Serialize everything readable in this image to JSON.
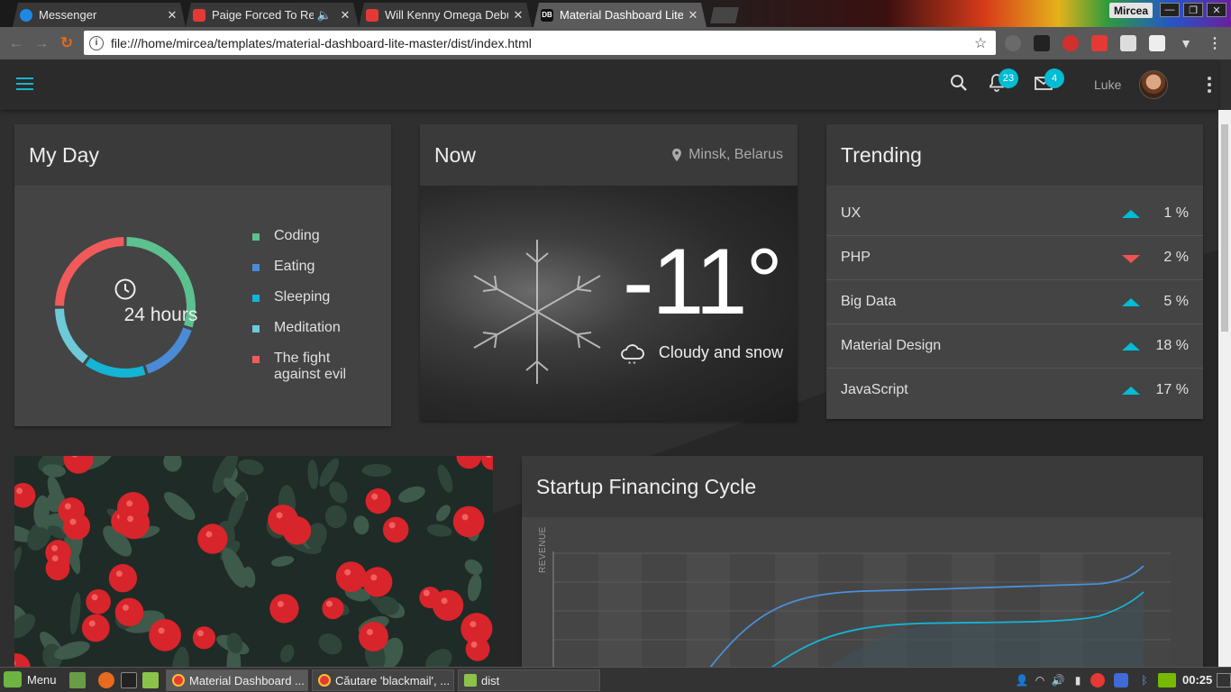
{
  "browser": {
    "tabs": [
      {
        "title": "Messenger",
        "close": "✕",
        "favicon_color": "#1e88e5"
      },
      {
        "title": "Paige Forced To Reti",
        "close": "✕",
        "favicon_color": "#e53935"
      },
      {
        "title": "Will Kenny Omega Debu",
        "close": "✕",
        "favicon_color": "#e53935"
      },
      {
        "title": "Material Dashboard Lite",
        "close": "✕",
        "favicon_text": "DB"
      }
    ],
    "profile_name": "Mircea",
    "window_buttons": {
      "minimize": "—",
      "maximize": "❐",
      "close": "✕"
    },
    "url": "file:///home/mircea/templates/material-dashboard-lite-master/dist/index.html",
    "info_glyph": "i",
    "star_glyph": "☆",
    "nav": {
      "back": "←",
      "forward": "→",
      "reload": "↻"
    }
  },
  "header": {
    "notifications_count": "23",
    "messages_count": "4",
    "user_name": "Luke"
  },
  "my_day": {
    "title": "My Day",
    "center_label": "24 hours",
    "segments": [
      {
        "label": "Coding",
        "color": "#5cc18e",
        "value": 30
      },
      {
        "label": "Eating",
        "color": "#4a8ad6",
        "value": 15
      },
      {
        "label": "Sleeping",
        "color": "#14b4d4",
        "value": 15
      },
      {
        "label": "Meditation",
        "color": "#6ec9d8",
        "value": 15
      },
      {
        "label": "The fight against evil",
        "color": "#f15a5a",
        "value": 25
      }
    ]
  },
  "now": {
    "title": "Now",
    "location": "Minsk, Belarus",
    "temperature": "-11°",
    "condition": "Cloudy and snow"
  },
  "trending": {
    "title": "Trending",
    "items": [
      {
        "name": "UX",
        "direction": "up",
        "percent": "1 %"
      },
      {
        "name": "PHP",
        "direction": "down",
        "percent": "2 %"
      },
      {
        "name": "Big Data",
        "direction": "up",
        "percent": "5 %"
      },
      {
        "name": "Material Design",
        "direction": "up",
        "percent": "18 %"
      },
      {
        "name": "JavaScript",
        "direction": "up",
        "percent": "17 %"
      }
    ]
  },
  "startup_chart": {
    "title": "Startup Financing Cycle",
    "ylabel": "REVENUE"
  },
  "taskbar": {
    "menu_label": "Menu",
    "windows": [
      {
        "label": "Material Dashboard ...",
        "icon_color": "#e53935"
      },
      {
        "label": "Căutare 'blackmail', ...",
        "icon_color": "#e53935"
      },
      {
        "label": "dist",
        "icon_color": "#8bc34a"
      }
    ],
    "clock": "00:25"
  }
}
